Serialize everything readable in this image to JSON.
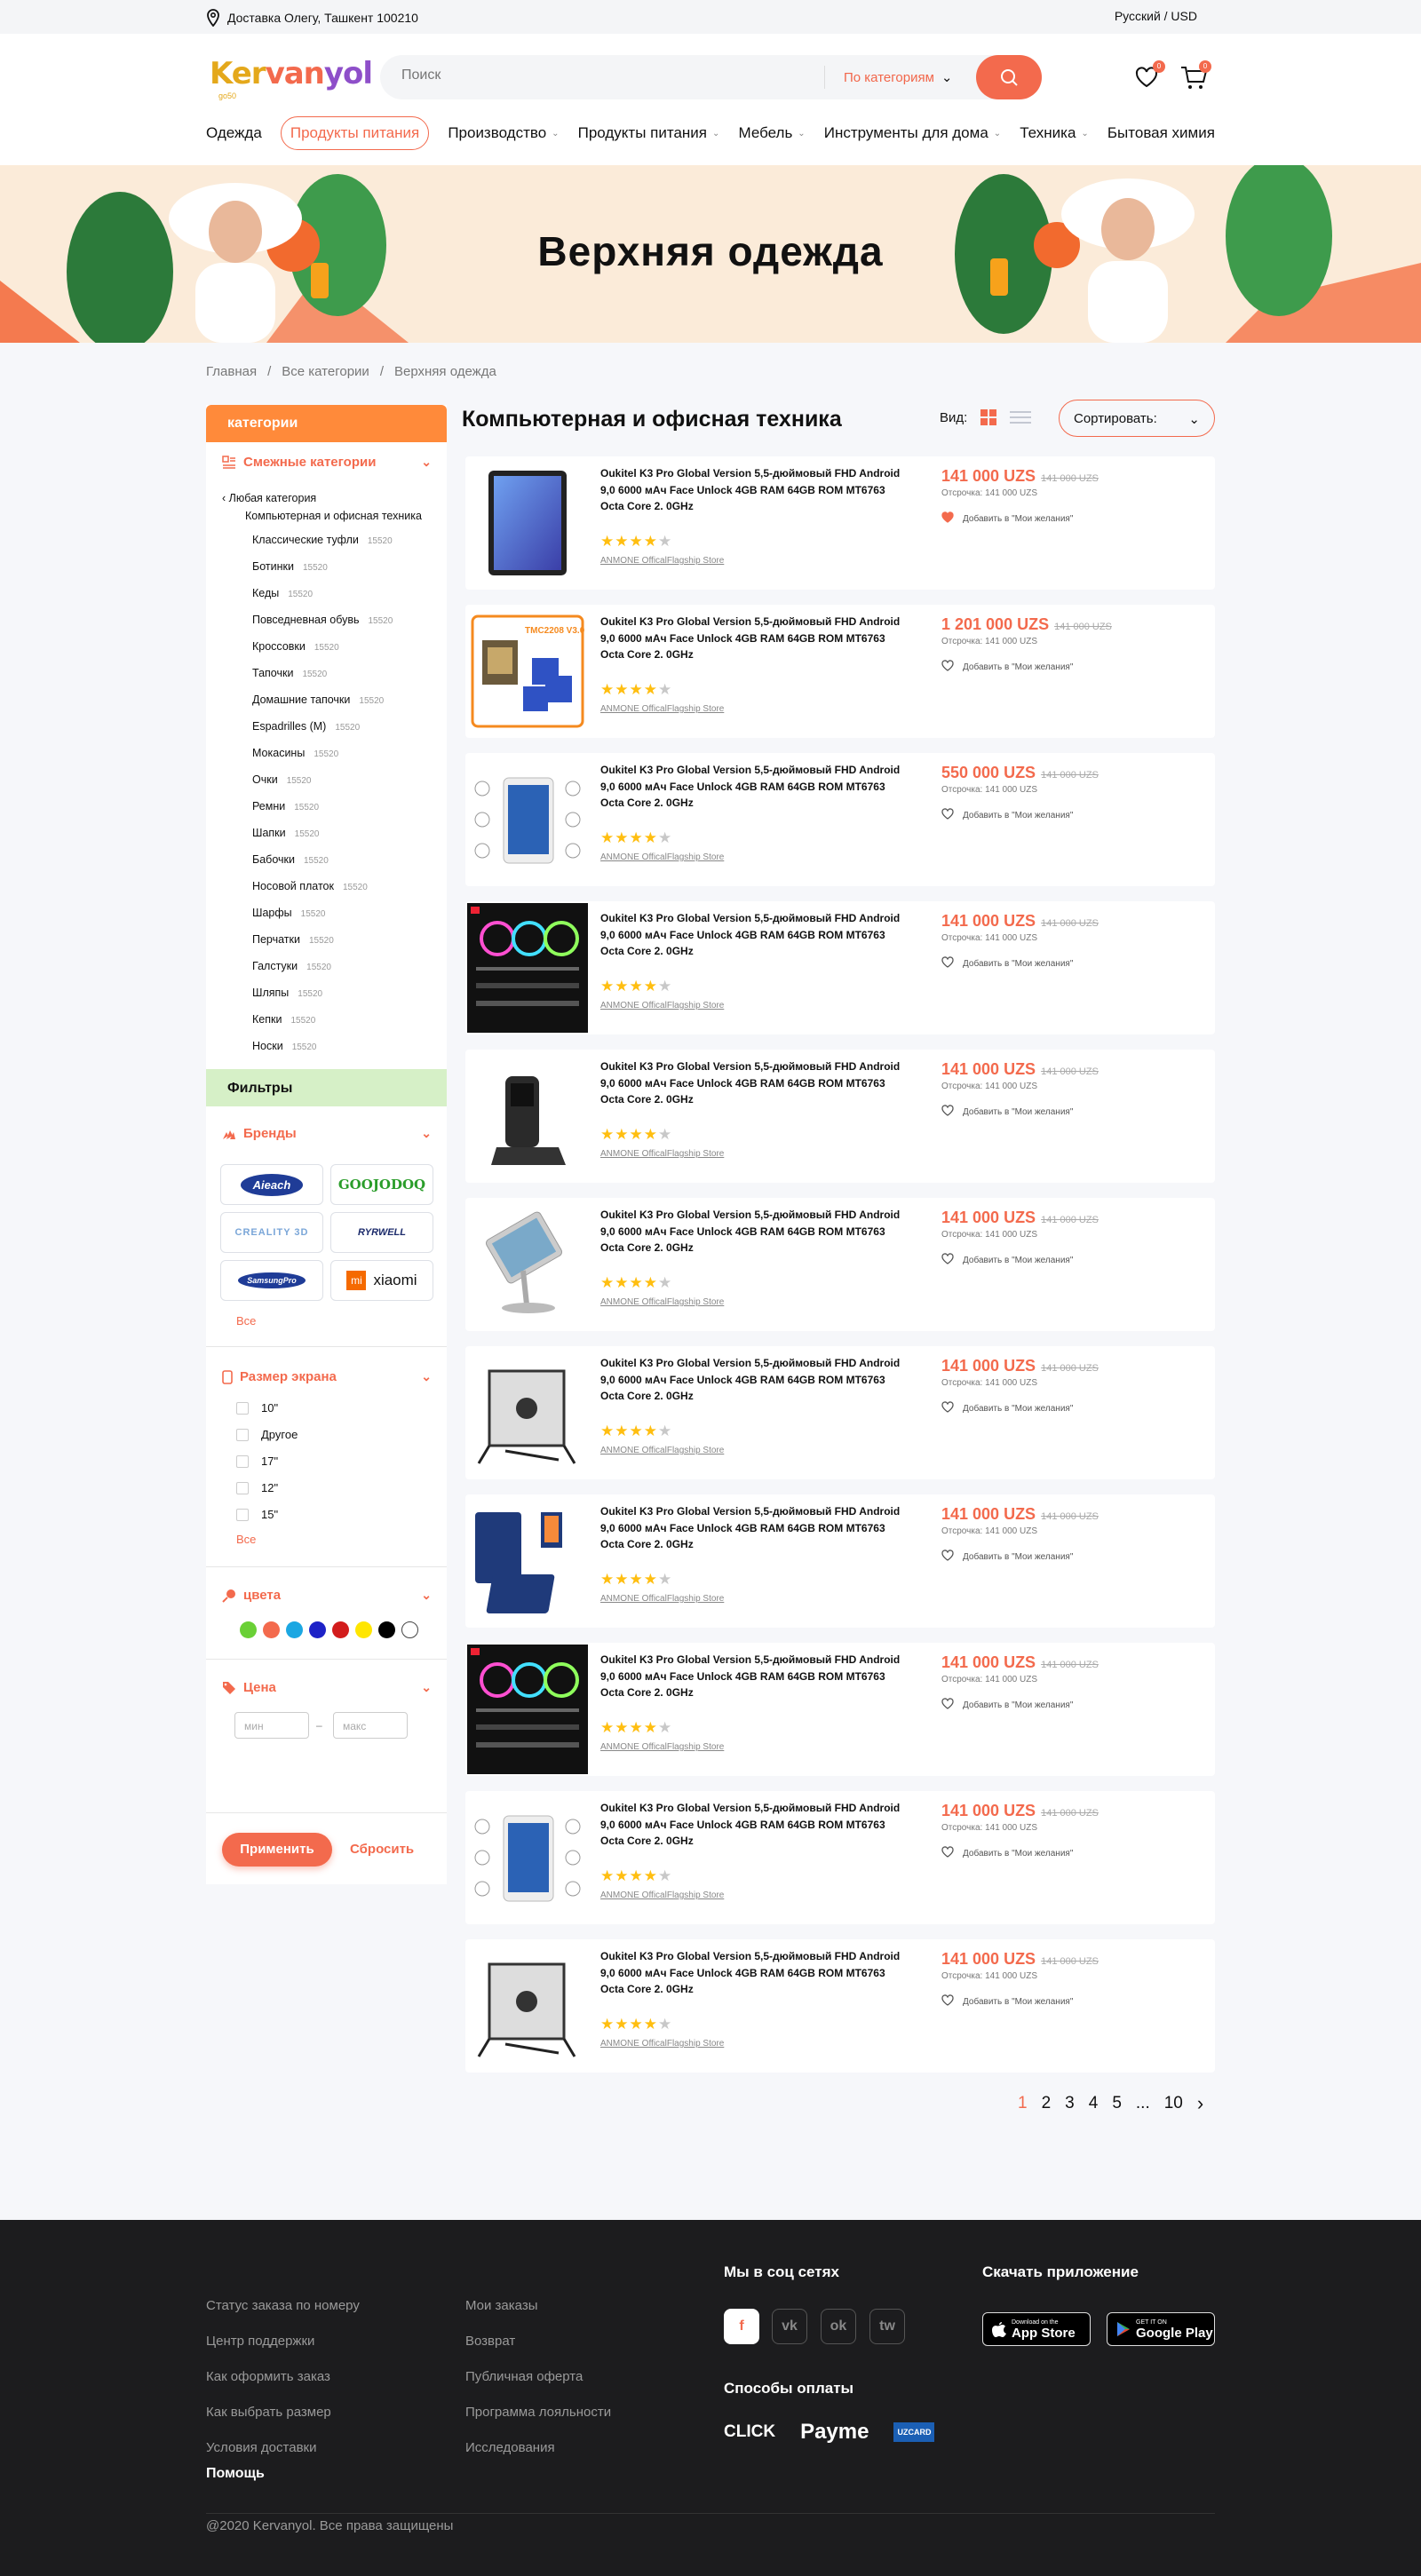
{
  "topbar": {
    "address": "Доставка Олегу, Ташкент 100210",
    "language": "Русский / USD"
  },
  "header": {
    "logo": "Kervanyol",
    "logo_sub": "go50",
    "search_placeholder": "Поиск",
    "search_category": "По категориям",
    "wishlist_count": "0",
    "cart_count": "0"
  },
  "nav": [
    {
      "label": "Одежда",
      "active": false,
      "dropdown": false
    },
    {
      "label": "Продукты питания",
      "active": true,
      "dropdown": false
    },
    {
      "label": "Производство",
      "active": false,
      "dropdown": true
    },
    {
      "label": "Продукты питания",
      "active": false,
      "dropdown": true
    },
    {
      "label": "Мебель",
      "active": false,
      "dropdown": true
    },
    {
      "label": "Инструменты для дома",
      "active": false,
      "dropdown": true
    },
    {
      "label": "Техника",
      "active": false,
      "dropdown": true
    },
    {
      "label": "Бытовая химия",
      "active": false,
      "dropdown": false
    }
  ],
  "banner": {
    "title": "Верхняя одежда"
  },
  "breadcrumbs": [
    "Главная",
    "Все категории",
    "Верхняя одежда"
  ],
  "sidebar": {
    "title": "категории",
    "related_title": "Смежные категории",
    "back_label": "Любая категория",
    "current_label": "Компьютерная и офисная техника",
    "categories": [
      {
        "name": "Классические туфли",
        "count": "15520"
      },
      {
        "name": "Ботинки",
        "count": "15520"
      },
      {
        "name": "Кеды",
        "count": "15520"
      },
      {
        "name": "Повседневная обувь",
        "count": "15520"
      },
      {
        "name": "Кроссовки",
        "count": "15520"
      },
      {
        "name": "Тапочки",
        "count": "15520"
      },
      {
        "name": "Домашние тапочки",
        "count": "15520"
      },
      {
        "name": "Espadrilles (M)",
        "count": "15520"
      },
      {
        "name": "Мокасины",
        "count": "15520"
      },
      {
        "name": "Очки",
        "count": "15520"
      },
      {
        "name": "Ремни",
        "count": "15520"
      },
      {
        "name": "Шапки",
        "count": "15520"
      },
      {
        "name": "Бабочки",
        "count": "15520"
      },
      {
        "name": "Носовой платок",
        "count": "15520"
      },
      {
        "name": "Шарфы",
        "count": "15520"
      },
      {
        "name": "Перчатки",
        "count": "15520"
      },
      {
        "name": "Галстуки",
        "count": "15520"
      },
      {
        "name": "Шляпы",
        "count": "15520"
      },
      {
        "name": "Кепки",
        "count": "15520"
      },
      {
        "name": "Носки",
        "count": "15520"
      }
    ],
    "filters_title": "Фильтры",
    "brands_title": "Бренды",
    "brands": [
      "Aieach",
      "GOOJODOQ",
      "CREALITY 3D",
      "RYRWELL",
      "SamsungPro",
      "xiaomi"
    ],
    "all_label": "Все",
    "screen_title": "Размер экрана",
    "screen_sizes": [
      "10\"",
      "Другое",
      "17\"",
      "12\"",
      "15\""
    ],
    "colors_title": "цвета",
    "colors": [
      "#6ad036",
      "#f36a4d",
      "#1ba7e2",
      "#1d22c7",
      "#d21c1c",
      "#ffe600",
      "#000000",
      "#ffffff"
    ],
    "price_title": "Цена",
    "price_min_placeholder": "мин",
    "price_max_placeholder": "макс",
    "price_dash": "–",
    "apply_label": "Применить",
    "reset_label": "Сбросить"
  },
  "main": {
    "title": "Компьютерная и офисная техника",
    "view_label": "Вид:",
    "sort_label": "Сортировать:"
  },
  "products": [
    {
      "name": "Oukitel K3 Pro Global Version 5,5-дюймовый FHD Android 9,0 6000 мАч Face Unlock 4GB RAM 64GB ROM MT6763 Octa Core 2. 0GHz",
      "price": "141 000 UZS",
      "old_price": "141 000 UZS",
      "installment": "Отсрочка: 141 000 UZS",
      "wishlist": "Добавить в \"Мои желания\"",
      "store": "ANMONE OfficalFlagship Store",
      "rating": 4,
      "image": "tablet-blue",
      "wished": true
    },
    {
      "name": "Oukitel K3 Pro Global Version 5,5-дюймовый FHD Android 9,0 6000 мАч Face Unlock 4GB RAM 64GB ROM MT6763 Octa Core 2. 0GHz",
      "price": "1 201 000 UZS",
      "old_price": "141 000 UZS",
      "installment": "Отсрочка: 141 000 UZS",
      "wishlist": "Добавить в \"Мои желания\"",
      "store": "ANMONE OfficalFlagship Store",
      "rating": 4,
      "image": "stepper-driver",
      "wished": false
    },
    {
      "name": "Oukitel K3 Pro Global Version 5,5-дюймовый FHD Android 9,0 6000 мАч Face Unlock 4GB RAM 64GB ROM MT6763 Octa Core 2. 0GHz",
      "price": "550 000 UZS",
      "old_price": "141 000 UZS",
      "installment": "Отсрочка: 141 000 UZS",
      "wishlist": "Добавить в \"Мои желания\"",
      "store": "ANMONE OfficalFlagship Store",
      "rating": 4,
      "image": "tablet-white",
      "wished": false
    },
    {
      "name": "Oukitel K3 Pro Global Version 5,5-дюймовый FHD Android 9,0 6000 мАч Face Unlock 4GB RAM 64GB ROM MT6763 Octa Core 2. 0GHz",
      "price": "141 000 UZS",
      "old_price": "141 000 UZS",
      "installment": "Отсрочка: 141 000 UZS",
      "wishlist": "Добавить в \"Мои желания\"",
      "store": "ANMONE OfficalFlagship Store",
      "rating": 4,
      "image": "rgb-fans",
      "wished": false
    },
    {
      "name": "Oukitel K3 Pro Global Version 5,5-дюймовый FHD Android 9,0 6000 мАч Face Unlock 4GB RAM 64GB ROM MT6763 Octa Core 2. 0GHz",
      "price": "141 000 UZS",
      "old_price": "141 000 UZS",
      "installment": "Отсрочка: 141 000 UZS",
      "wishlist": "Добавить в \"Мои желания\"",
      "store": "ANMONE OfficalFlagship Store",
      "rating": 4,
      "image": "scanner",
      "wished": false
    },
    {
      "name": "Oukitel K3 Pro Global Version 5,5-дюймовый FHD Android 9,0 6000 мАч Face Unlock 4GB RAM 64GB ROM MT6763 Octa Core 2. 0GHz",
      "price": "141 000 UZS",
      "old_price": "141 000 UZS",
      "installment": "Отсрочка: 141 000 UZS",
      "wishlist": "Добавить в \"Мои желания\"",
      "store": "ANMONE OfficalFlagship Store",
      "rating": 4,
      "image": "tablet-stand",
      "wished": false
    },
    {
      "name": "Oukitel K3 Pro Global Version 5,5-дюймовый FHD Android 9,0 6000 мАч Face Unlock 4GB RAM 64GB ROM MT6763 Octa Core 2. 0GHz",
      "price": "141 000 UZS",
      "old_price": "141 000 UZS",
      "installment": "Отсрочка: 141 000 UZS",
      "wishlist": "Добавить в \"Мои желания\"",
      "store": "ANMONE OfficalFlagship Store",
      "rating": 4,
      "image": "metal-stand",
      "wished": false
    },
    {
      "name": "Oukitel K3 Pro Global Version 5,5-дюймовый FHD Android 9,0 6000 мАч Face Unlock 4GB RAM 64GB ROM MT6763 Octa Core 2. 0GHz",
      "price": "141 000 UZS",
      "old_price": "141 000 UZS",
      "installment": "Отсрочка: 141 000 UZS",
      "wishlist": "Добавить в \"Мои желания\"",
      "store": "ANMONE OfficalFlagship Store",
      "rating": 4,
      "image": "tablet-case",
      "wished": false
    },
    {
      "name": "Oukitel K3 Pro Global Version 5,5-дюймовый FHD Android 9,0 6000 мАч Face Unlock 4GB RAM 64GB ROM MT6763 Octa Core 2. 0GHz",
      "price": "141 000 UZS",
      "old_price": "141 000 UZS",
      "installment": "Отсрочка: 141 000 UZS",
      "wishlist": "Добавить в \"Мои желания\"",
      "store": "ANMONE OfficalFlagship Store",
      "rating": 4,
      "image": "rgb-fans",
      "wished": false
    },
    {
      "name": "Oukitel K3 Pro Global Version 5,5-дюймовый FHD Android 9,0 6000 мАч Face Unlock 4GB RAM 64GB ROM MT6763 Octa Core 2. 0GHz",
      "price": "141 000 UZS",
      "old_price": "141 000 UZS",
      "installment": "Отсрочка: 141 000 UZS",
      "wishlist": "Добавить в \"Мои желания\"",
      "store": "ANMONE OfficalFlagship Store",
      "rating": 4,
      "image": "tablet-white",
      "wished": false
    },
    {
      "name": "Oukitel K3 Pro Global Version 5,5-дюймовый FHD Android 9,0 6000 мАч Face Unlock 4GB RAM 64GB ROM MT6763 Octa Core 2. 0GHz",
      "price": "141 000 UZS",
      "old_price": "141 000 UZS",
      "installment": "Отсрочка: 141 000 UZS",
      "wishlist": "Добавить в \"Мои желания\"",
      "store": "ANMONE OfficalFlagship Store",
      "rating": 4,
      "image": "metal-stand",
      "wished": false
    }
  ],
  "pagination": {
    "pages": [
      "1",
      "2",
      "3",
      "4",
      "5",
      "...",
      "10"
    ],
    "current": "1"
  },
  "footer": {
    "col1": [
      "Статус заказа по номеру",
      "Центр поддержки",
      "Как оформить заказ",
      "Как выбрать размер",
      "Условия доставки"
    ],
    "col2": [
      "Мои заказы",
      "Возврат",
      "Публичная оферта",
      "Программа лояльности",
      "Исследования"
    ],
    "help_label": "Помощь",
    "social_title": "Мы в соц сетях",
    "social": [
      "f",
      "vk",
      "ok",
      "tw"
    ],
    "payment_title": "Способы оплаты",
    "payments": [
      "CLICK",
      "Payme",
      "UZCARD"
    ],
    "app_title": "Скачать приложение",
    "appstore_small": "Download on the",
    "appstore": "App Store",
    "googleplay_small": "GET IT ON",
    "googleplay": "Google Play",
    "copyright": "@2020 Kervanyol. Все права защищены"
  }
}
